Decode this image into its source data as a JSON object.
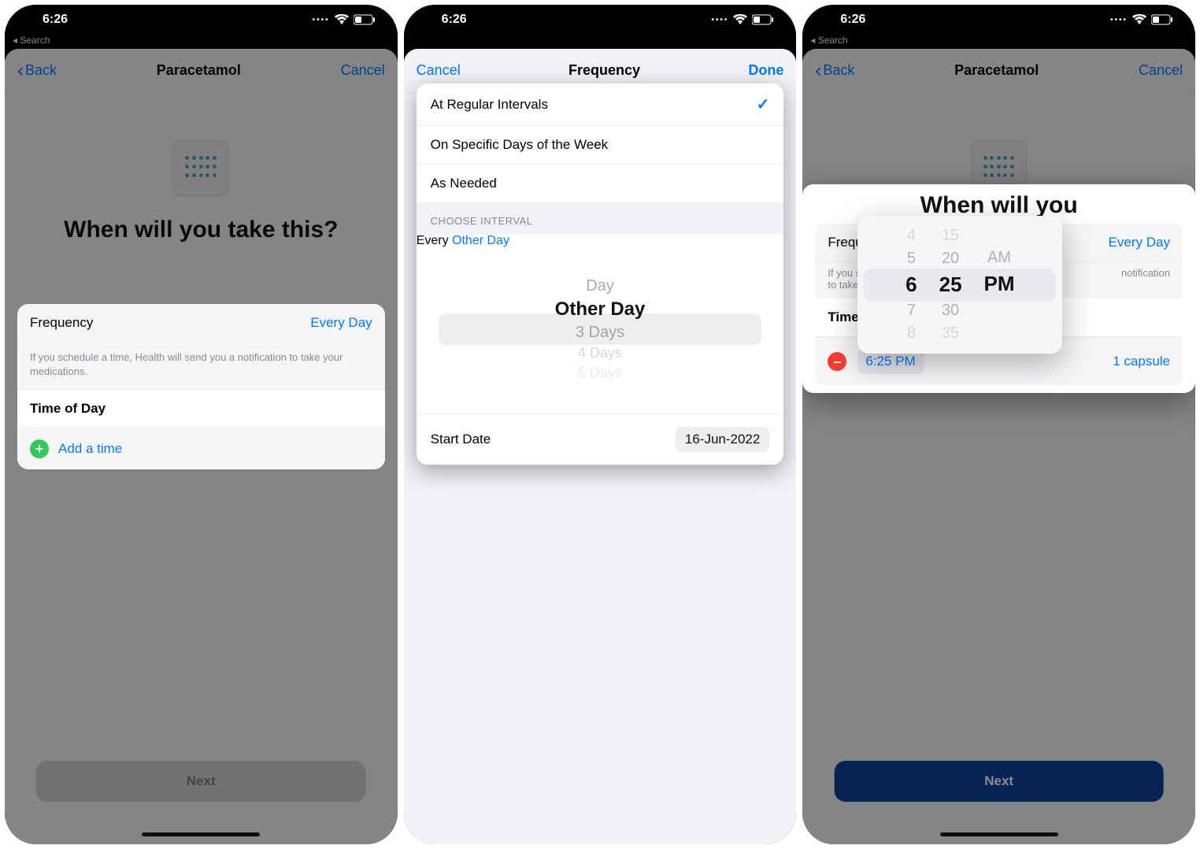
{
  "status": {
    "time": "6:26",
    "back_crumb": "Search"
  },
  "screen1": {
    "nav": {
      "back": "Back",
      "title": "Paracetamol",
      "cancel": "Cancel"
    },
    "heading": "When will you take this?",
    "freq_label": "Frequency",
    "freq_value": "Every Day",
    "hint": "If you schedule a time, Health will send you a notification to take your medications.",
    "tod_label": "Time of Day",
    "add_time": "Add a time",
    "next": "Next"
  },
  "screen2": {
    "nav": {
      "cancel": "Cancel",
      "title": "Frequency",
      "done": "Done"
    },
    "options": {
      "regular": "At Regular Intervals",
      "specific": "On Specific Days of the Week",
      "asneeded": "As Needed"
    },
    "section": "CHOOSE INTERVAL",
    "every_label": "Every",
    "every_value": "Other Day",
    "picker": {
      "p0": "Day",
      "sel": "Other Day",
      "p2": "3 Days",
      "p3": "4 Days",
      "p4": "5 Days"
    },
    "start_label": "Start Date",
    "start_value": "16-Jun-2022"
  },
  "screen3": {
    "nav": {
      "back": "Back",
      "title": "Paracetamol",
      "cancel": "Cancel"
    },
    "heading": "When will you",
    "freq_label": "Frequ",
    "freq_value": "Every Day",
    "hint_left": "If you s",
    "hint_right": "notification",
    "hint_line2": "to take",
    "tod_label": "Time",
    "time_value": "6:25 PM",
    "cap_value": "1 capsule",
    "next": "Next",
    "time_picker": {
      "hours": {
        "f2a": "4",
        "f1a": "5",
        "sel": "6",
        "f1b": "7",
        "f2b": "8"
      },
      "mins": {
        "f2a": "15",
        "f1a": "20",
        "sel": "25",
        "f1b": "30",
        "f2b": "35"
      },
      "ampm": {
        "am": "AM",
        "pm": "PM"
      }
    }
  }
}
